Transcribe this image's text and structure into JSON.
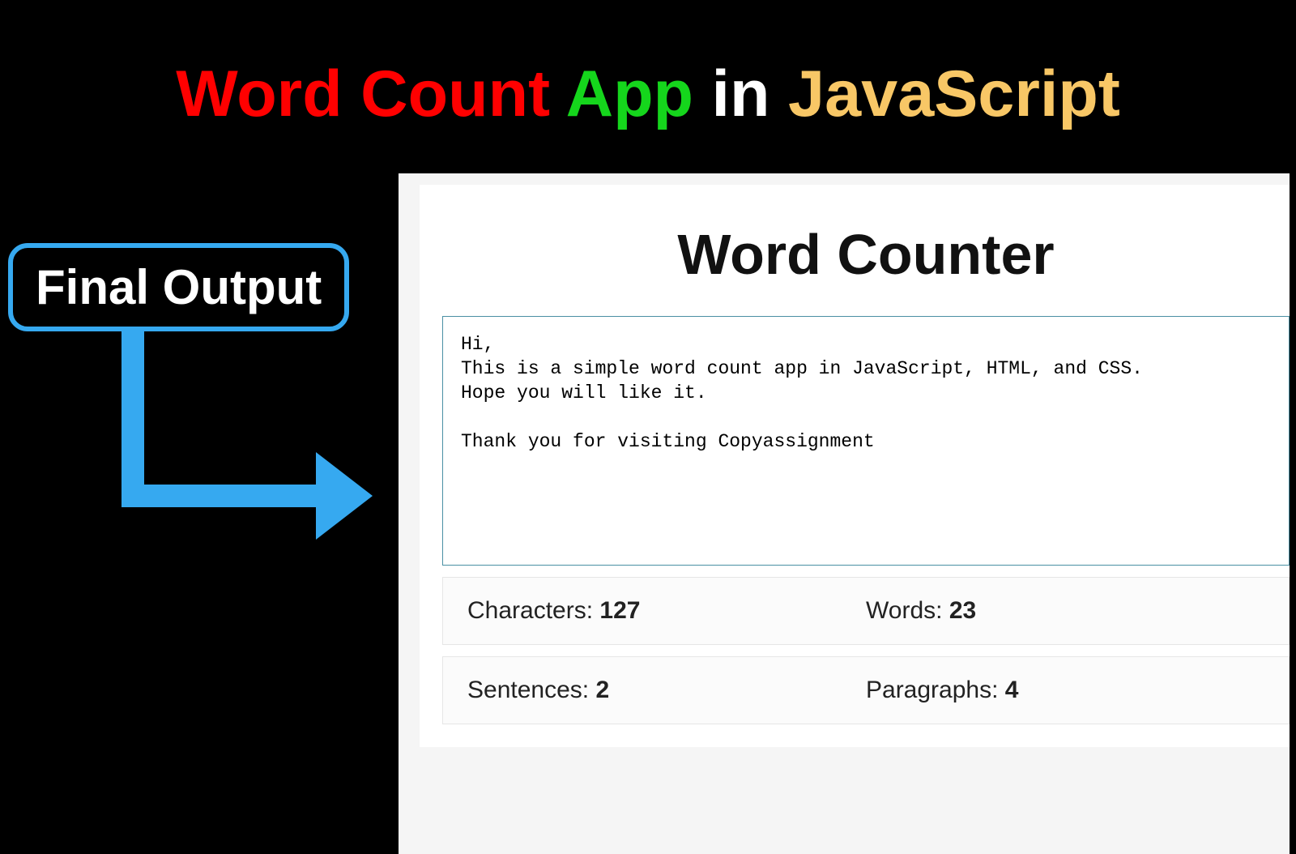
{
  "title": {
    "part1": "Word Count",
    "part2": "App",
    "part3": "in",
    "part4": "JavaScript"
  },
  "badge": {
    "label": "Final Output"
  },
  "app": {
    "heading": "Word Counter",
    "text_content": "Hi,\nThis is a simple word count app in JavaScript, HTML, and CSS.\nHope you will like it.\n\nThank you for visiting Copyassignment",
    "stats": {
      "characters": {
        "label": "Characters: ",
        "value": "127"
      },
      "words": {
        "label": "Words: ",
        "value": "23"
      },
      "sentences": {
        "label": "Sentences: ",
        "value": "2"
      },
      "paragraphs": {
        "label": "Paragraphs: ",
        "value": "4"
      }
    }
  }
}
